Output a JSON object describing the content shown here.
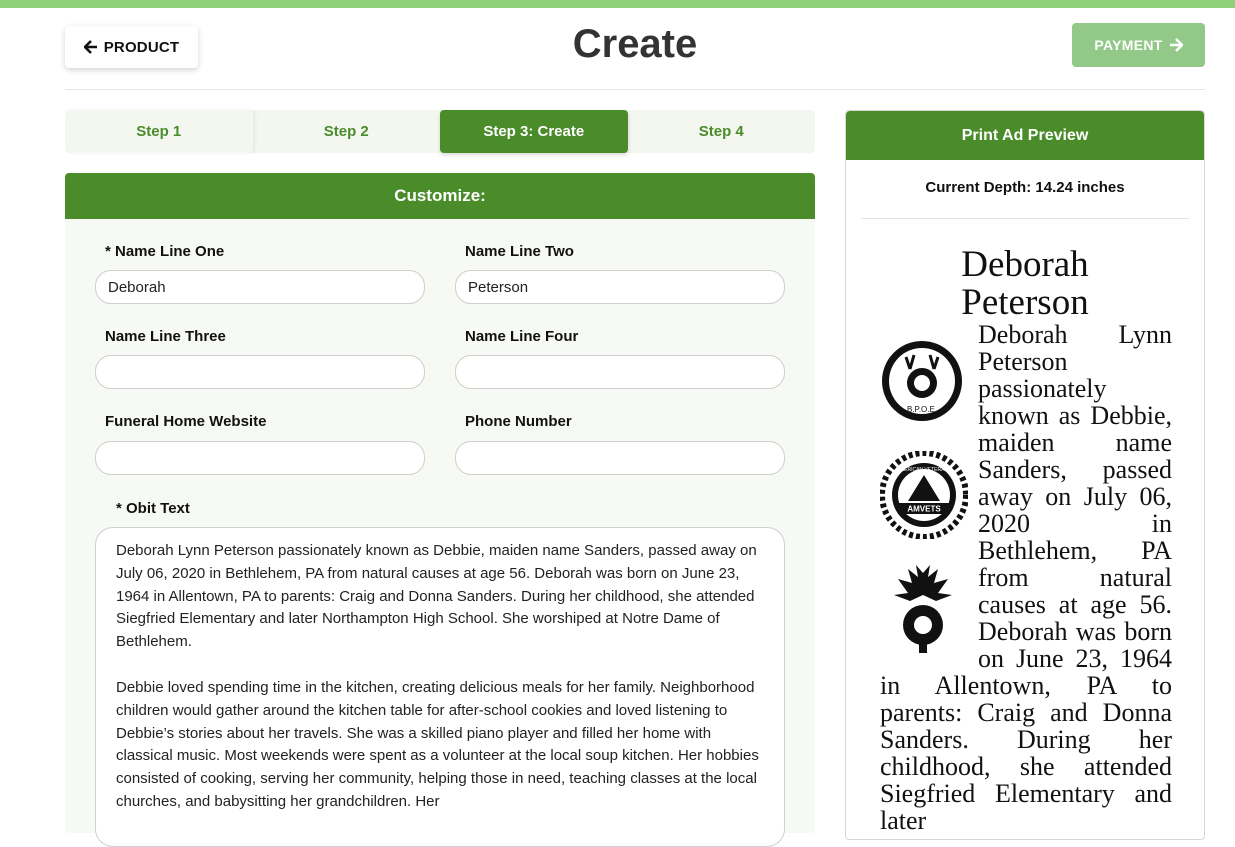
{
  "header": {
    "back_label": "PRODUCT",
    "title": "Create",
    "next_label": "PAYMENT"
  },
  "steps": [
    {
      "label": "Step 1",
      "active": false
    },
    {
      "label": "Step 2",
      "active": false
    },
    {
      "label": "Step 3: Create",
      "active": true
    },
    {
      "label": "Step 4",
      "active": false
    }
  ],
  "customize": {
    "title": "Customize:",
    "fields": {
      "name_line_one": {
        "label": "* Name Line One",
        "value": "Deborah"
      },
      "name_line_two": {
        "label": "Name Line Two",
        "value": "Peterson"
      },
      "name_line_three": {
        "label": "Name Line Three",
        "value": ""
      },
      "name_line_four": {
        "label": "Name Line Four",
        "value": ""
      },
      "funeral_home_website": {
        "label": "Funeral Home Website",
        "value": ""
      },
      "phone_number": {
        "label": "Phone Number",
        "value": ""
      }
    },
    "obit": {
      "label": "* Obit Text",
      "paragraph1": "Deborah Lynn Peterson passionately known as Debbie, maiden name Sanders, passed away on July 06, 2020 in Bethlehem, PA from natural causes at age 56. Deborah was born on June 23, 1964 in Allentown, PA to parents: Craig and Donna Sanders. During her childhood, she attended Siegfried Elementary and later Northampton High School. She worshiped at Notre Dame of Bethlehem.",
      "paragraph2": "Debbie loved spending time in the kitchen, creating delicious meals for her family. Neighborhood children would gather around the kitchen table for after-school cookies and loved listening to Debbie’s stories about her travels. She was a skilled piano player and filled her home with classical music. Most weekends were spent as a volunteer at the local soup kitchen. Her hobbies consisted of cooking, serving her community, helping those in need, teaching classes at the local churches, and babysitting her grandchildren. Her"
    }
  },
  "preview": {
    "title": "Print Ad Preview",
    "depth": "Current Depth: 14.24 inches",
    "ad_name_line1": "Deborah",
    "ad_name_line2": "Peterson",
    "ad_text": "Deborah Lynn Peterson passionately known as Debbie, maiden name Sanders, passed away on July 06, 2020 in Bethlehem, PA from natural causes at age 56. Deborah was born on June 23, 1964 in Allentown, PA to parents: Craig and Donna Sanders. During her childhood, she attended Siegfried Elementary and later",
    "emblem_elks_text": "B.P.O.E.",
    "emblem_amvets_text": "AMVETS",
    "emblem_amvets_ring": "AMERICAN VETERANS"
  }
}
